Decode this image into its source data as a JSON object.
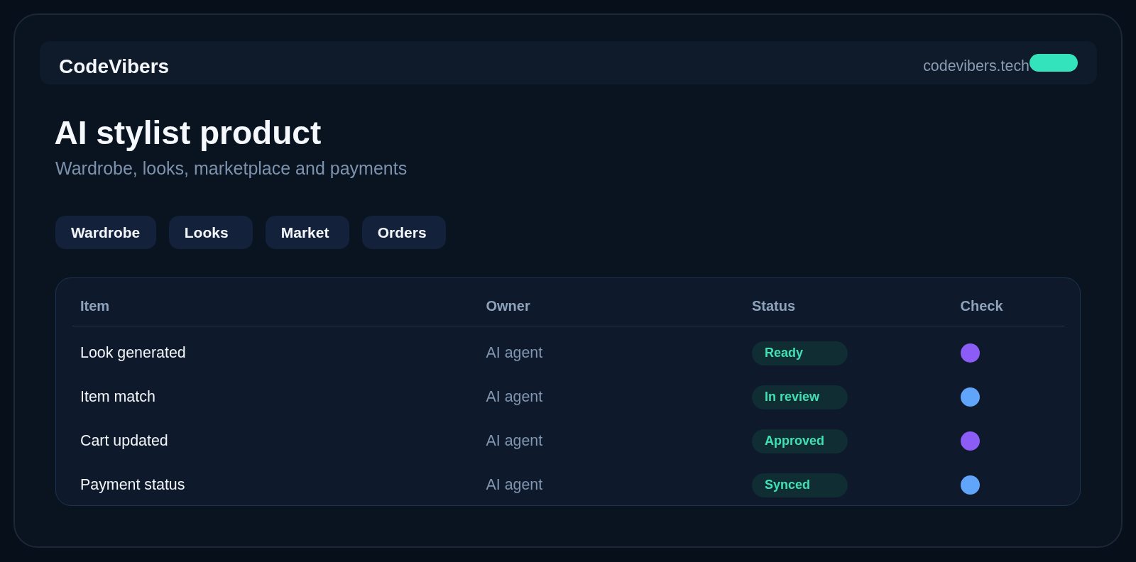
{
  "brand": {
    "name": "CodeVibers",
    "domain": "codevibers.tech"
  },
  "hero": {
    "title": "AI stylist product",
    "subtitle": "Wardrobe, looks, marketplace and payments"
  },
  "tabs": [
    "Wardrobe",
    "Looks",
    "Market",
    "Orders"
  ],
  "table": {
    "columns": [
      "Item",
      "Owner",
      "Status",
      "Check"
    ],
    "rows": [
      {
        "item": "Look generated",
        "owner": "AI agent",
        "status": "Ready",
        "color": "#8b5cf6"
      },
      {
        "item": "Item match",
        "owner": "AI agent",
        "status": "In review",
        "color": "#60a5fa"
      },
      {
        "item": "Cart updated",
        "owner": "AI agent",
        "status": "Approved",
        "color": "#8b5cf6"
      },
      {
        "item": "Payment status",
        "owner": "AI agent",
        "status": "Synced",
        "color": "#60a5fa"
      }
    ]
  }
}
